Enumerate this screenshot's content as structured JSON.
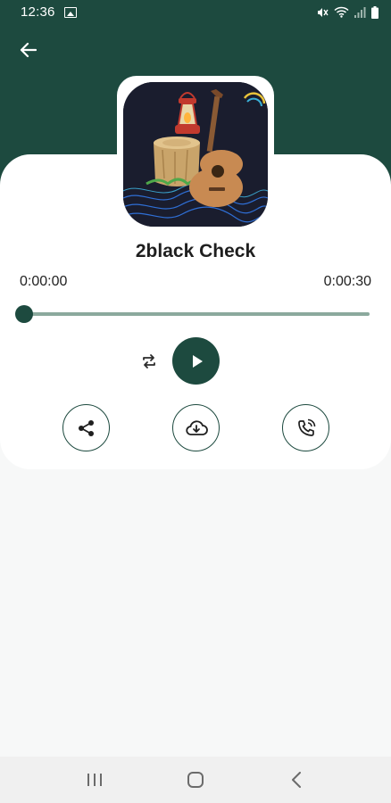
{
  "status_bar": {
    "time": "12:36",
    "icons": [
      "gallery-icon",
      "mute-icon",
      "wifi-icon",
      "signal-icon",
      "battery-icon"
    ]
  },
  "header": {
    "back_icon": "arrow-left-icon",
    "background_color": "#1d4a3f"
  },
  "player": {
    "title": "2black Check",
    "current_time": "0:00:00",
    "duration": "0:00:30",
    "progress": 0.0,
    "repeat_icon": "repeat-icon",
    "play_icon": "play-icon"
  },
  "actions": [
    {
      "name": "share",
      "icon": "share-icon"
    },
    {
      "name": "download",
      "icon": "cloud-download-icon"
    },
    {
      "name": "set-ringtone",
      "icon": "phone-ring-icon"
    }
  ],
  "nav_bar": {
    "items": [
      {
        "name": "recents",
        "icon": "recents-icon"
      },
      {
        "name": "home",
        "icon": "home-icon"
      },
      {
        "name": "back",
        "icon": "back-chevron-icon"
      }
    ]
  },
  "colors": {
    "primary": "#1d4a3f",
    "track": "#8ba99d",
    "card": "#ffffff",
    "page": "#f7f8f8"
  }
}
